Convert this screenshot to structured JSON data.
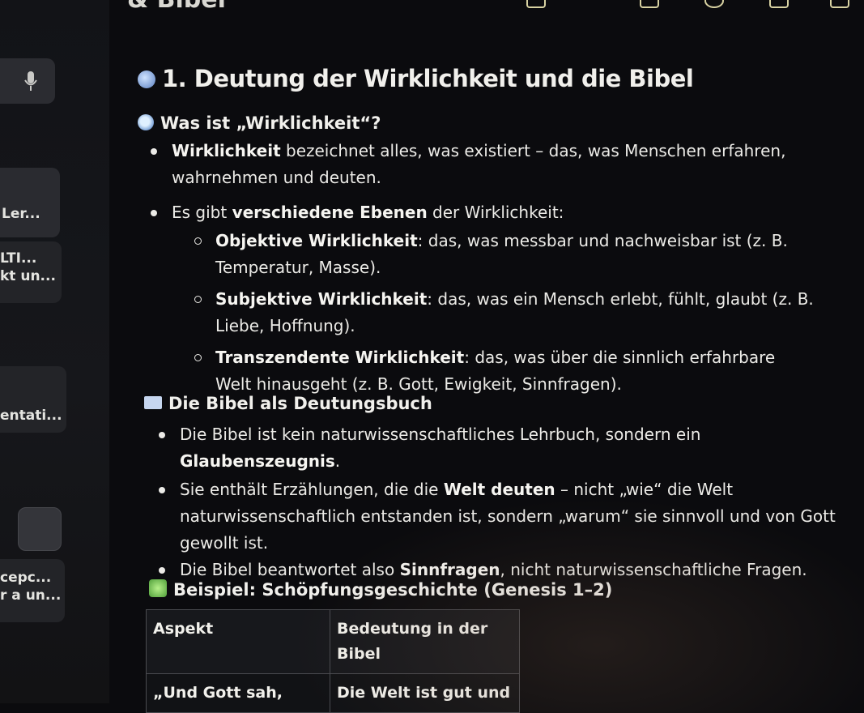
{
  "top_heading_partial": "& Bibel",
  "sidebar": {
    "cards": [
      {
        "lines": [
          "Ler..."
        ]
      },
      {
        "lines": [
          "LTI...",
          "kt un..."
        ]
      },
      {
        "lines": [
          "entati..."
        ]
      },
      {
        "lines": [
          "cepc...",
          "r a un..."
        ]
      }
    ]
  },
  "main": {
    "title": "1. Deutung der Wirklichkeit und die Bibel",
    "section1": {
      "heading": "Was ist „Wirklichkeit“?",
      "item1": {
        "bold": "Wirklichkeit",
        "text": " bezeichnet alles, was existiert – das, was Menschen erfahren, wahrnehmen und deuten."
      },
      "item2": {
        "pre": "Es gibt ",
        "bold": "verschiedene Ebenen",
        "post": " der Wirklichkeit:"
      },
      "sub1": {
        "bold": "Objektive Wirklichkeit",
        "text": ": das, was messbar und nachweisbar ist (z. B. Temperatur, Masse)."
      },
      "sub2": {
        "bold": "Subjektive Wirklichkeit",
        "text": ": das, was ein Mensch erlebt, fühlt, glaubt (z. B. Liebe, Hoffnung)."
      },
      "sub3": {
        "bold": "Transzendente Wirklichkeit",
        "text": ": das, was über die sinnlich erfahrbare Welt hinausgeht (z. B. Gott, Ewigkeit, Sinnfragen)."
      }
    },
    "section2": {
      "heading": "Die Bibel als Deutungsbuch",
      "item1": {
        "pre": "Die Bibel ist kein naturwissenschaftliches Lehrbuch, sondern ein ",
        "bold": "Glaubenszeugnis",
        "post": "."
      },
      "item2": {
        "pre": "Sie enthält Erzählungen, die die ",
        "bold": "Welt deuten",
        "post": " – nicht „wie“ die Welt naturwissenschaftlich entstanden ist, sondern „warum“ sie sinnvoll und von Gott gewollt ist."
      },
      "item3": {
        "pre": "Die Bibel beantwortet also ",
        "bold": "Sinnfragen",
        "post": ", nicht naturwissenschaftliche Fragen."
      }
    },
    "section3": {
      "heading": "Beispiel: Schöpfungsgeschichte (Genesis 1–2)",
      "table": {
        "headers": [
          "Aspekt",
          "Bedeutung in der Bibel"
        ],
        "row1": [
          "„Und Gott sah,",
          "Die Welt ist gut und"
        ]
      }
    }
  }
}
